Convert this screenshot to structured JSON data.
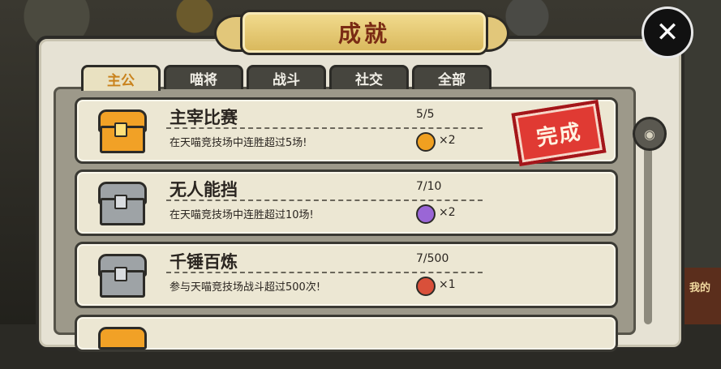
{
  "window": {
    "title": "成就"
  },
  "tabs": [
    {
      "label": "主公",
      "active": true
    },
    {
      "label": "喵将",
      "active": false
    },
    {
      "label": "战斗",
      "active": false
    },
    {
      "label": "社交",
      "active": false
    },
    {
      "label": "全部",
      "active": false
    }
  ],
  "close_label": "✕",
  "achievements": [
    {
      "title": "主宰比赛",
      "desc": "在天喵竞技场中连胜超过5场!",
      "progress": "5/5",
      "reward_icon": "gold-coin-icon",
      "reward_count": "×2",
      "chest": "gold-chest-icon",
      "stamp": "完成"
    },
    {
      "title": "无人能挡",
      "desc": "在天喵竞技场中连胜超过10场!",
      "progress": "7/10",
      "reward_icon": "purple-bag-icon",
      "reward_count": "×2",
      "chest": "silver-chest-icon",
      "stamp": ""
    },
    {
      "title": "千锤百炼",
      "desc": "参与天喵竞技场战斗超过500次!",
      "progress": "7/500",
      "reward_icon": "red-scroll-icon",
      "reward_count": "×1",
      "chest": "silver-chest-icon",
      "stamp": ""
    }
  ],
  "side_badge": "我的",
  "colors": {
    "gold": "#f1a126",
    "stamp_red": "#e03a33",
    "title_brown": "#7a2b14",
    "tab_active": "#c9821c"
  }
}
